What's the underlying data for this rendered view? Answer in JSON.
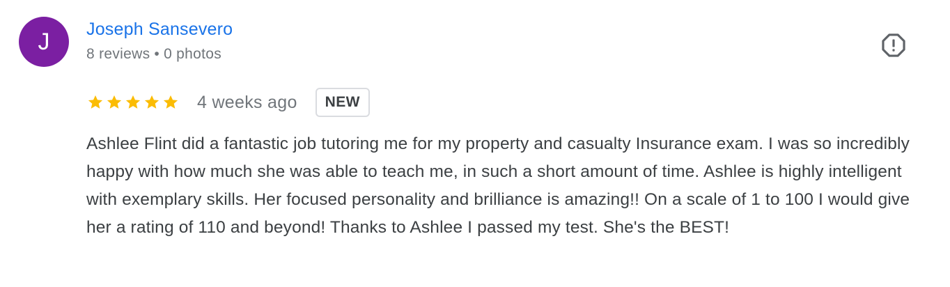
{
  "author": {
    "avatar_letter": "J",
    "avatar_color": "#7b1fa2",
    "name": "Joseph Sansevero",
    "reviews": "8 reviews",
    "separator": "•",
    "photos": "0 photos"
  },
  "actions": {
    "report_icon": "report-flag-icon"
  },
  "rating": {
    "stars": 5,
    "max_stars": 5,
    "star_color": "#fbbc04",
    "time": "4 weeks ago",
    "badge": "NEW"
  },
  "review": {
    "text": "Ashlee Flint did a fantastic job tutoring me for my property and casualty Insurance exam. I was so incredibly happy with how much she was able to teach me, in such a short amount of time. Ashlee is highly intelligent with exemplary skills. Her focused personality and brilliance is amazing!! On a scale of 1 to 100 I would give her a rating of 110 and beyond! Thanks to Ashlee I passed my test. She's the BEST!"
  },
  "colors": {
    "link": "#1a73e8",
    "secondary_text": "#70757a",
    "body_text": "#3c4043"
  }
}
